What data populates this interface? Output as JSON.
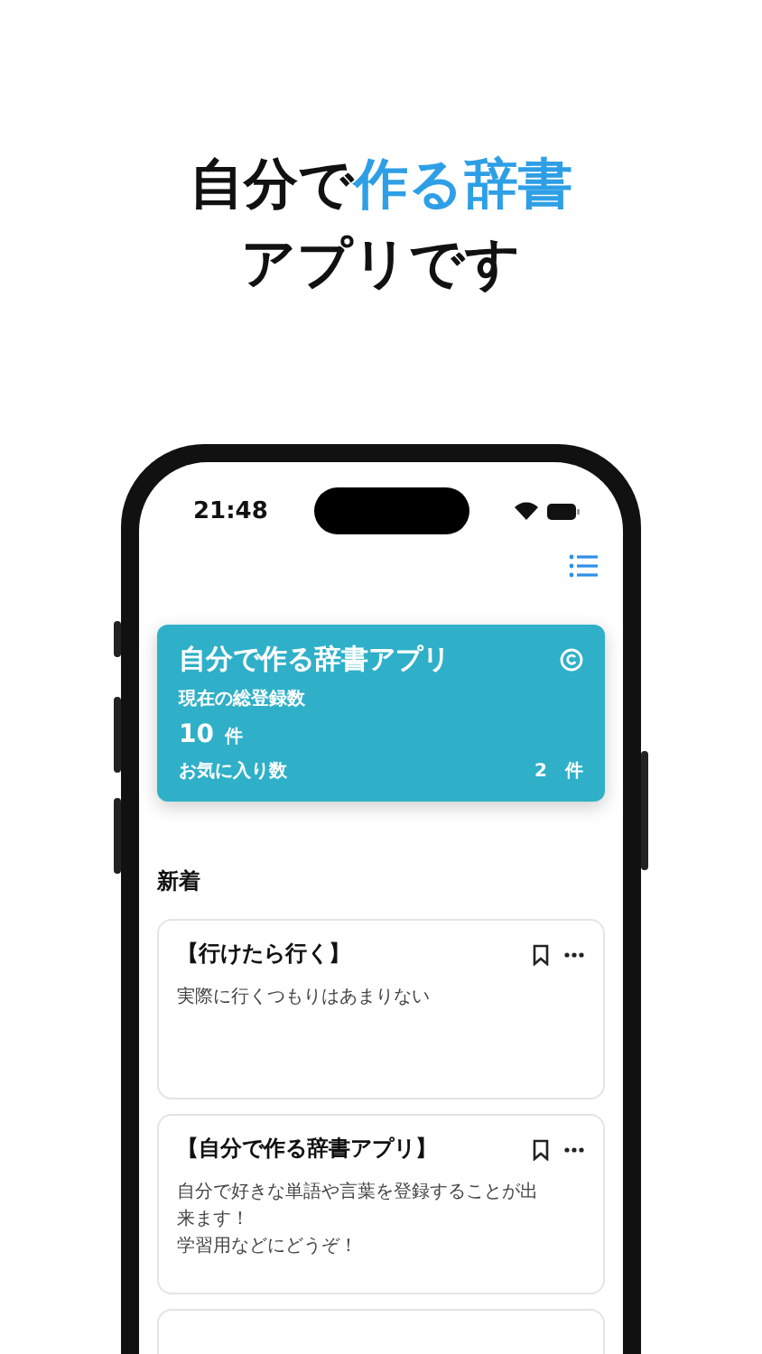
{
  "headline": {
    "lines": [
      [
        {
          "text": "自分で",
          "highlight": false
        },
        {
          "text": "作る辞書",
          "highlight": true
        }
      ],
      [
        {
          "text": "アプリです",
          "highlight": false
        }
      ]
    ]
  },
  "status_bar": {
    "time": "21:48"
  },
  "summary_card": {
    "title": "自分で作る辞書アプリ",
    "total_label": "現在の総登録数",
    "total_value": "10",
    "total_unit": "件",
    "favorites_label": "お気に入り数",
    "favorites_value": "2",
    "favorites_unit": "件"
  },
  "section_title": "新着",
  "entries": [
    {
      "title": "【行けたら行く】",
      "paragraphs": [
        "実際に行くつもりはあまりない"
      ]
    },
    {
      "title": "【自分で作る辞書アプリ】",
      "paragraphs": [
        "自分で好きな単語や言葉を登録することが出来ます！",
        "学習用などにどうぞ！"
      ]
    },
    {
      "kind": "cut"
    }
  ]
}
